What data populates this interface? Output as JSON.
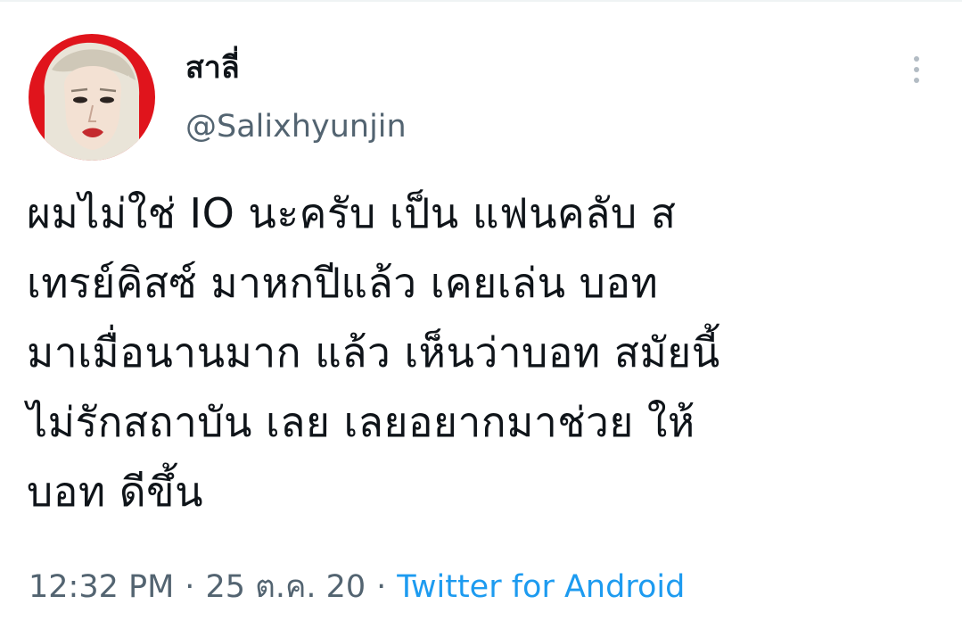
{
  "tweet": {
    "author": {
      "display_name": "สาลี่",
      "handle": "@Salixhyunjin",
      "avatar_icon": "profile-avatar"
    },
    "menu_icon": "more-vertical-icon",
    "text_lines": [
      "ผมไม่ใช่ IO นะครับ เป็น แฟนคลับ ส",
      "เทรย์คิสซ์ มาหกปีแล้ว เคยเล่น บอท",
      "มาเมื่อนานมาก แล้ว เห็นว่าบอท สมัยนี้",
      "ไม่รักสถาบัน เลย เลยอยากมาช่วย ให้",
      "บอท ดีขึ้น"
    ],
    "time": "12:32 PM",
    "separator": "·",
    "date": "25 ต.ค. 20",
    "source": "Twitter for Android"
  },
  "colors": {
    "text_primary": "#0f1419",
    "text_secondary": "#536471",
    "link": "#1d9bf0",
    "avatar_bg": "#e0141c"
  }
}
